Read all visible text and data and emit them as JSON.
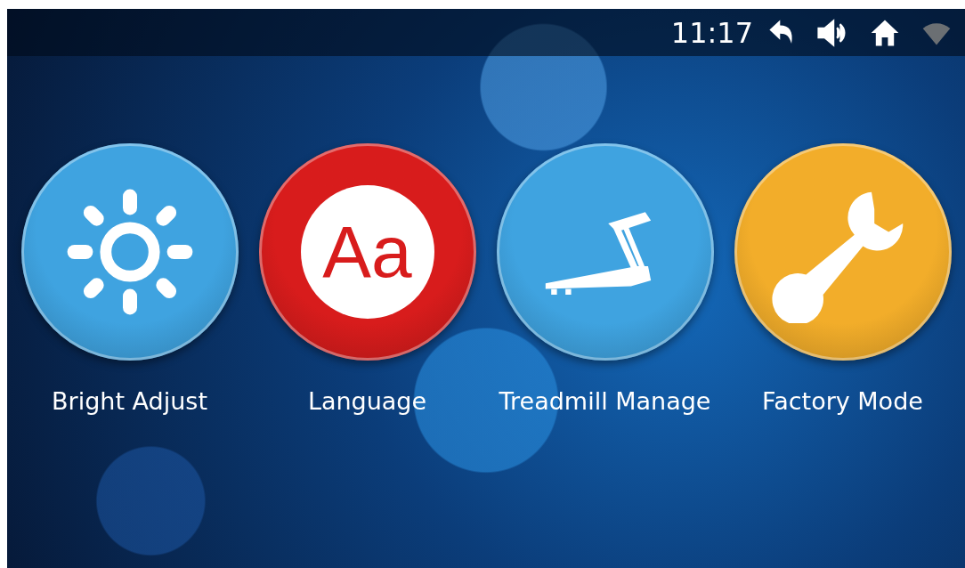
{
  "status_bar": {
    "time": "11:17"
  },
  "tiles": [
    {
      "label": "Bright Adjust",
      "kind": "sun",
      "color": "#3fa3e0"
    },
    {
      "label": "Language",
      "kind": "letters",
      "glyph": "Aa",
      "color": "#d81c1c"
    },
    {
      "label": "Treadmill Manage",
      "kind": "treadmill",
      "color": "#3fa3e0"
    },
    {
      "label": "Factory Mode",
      "kind": "wrench",
      "color": "#f2ad2a"
    }
  ]
}
